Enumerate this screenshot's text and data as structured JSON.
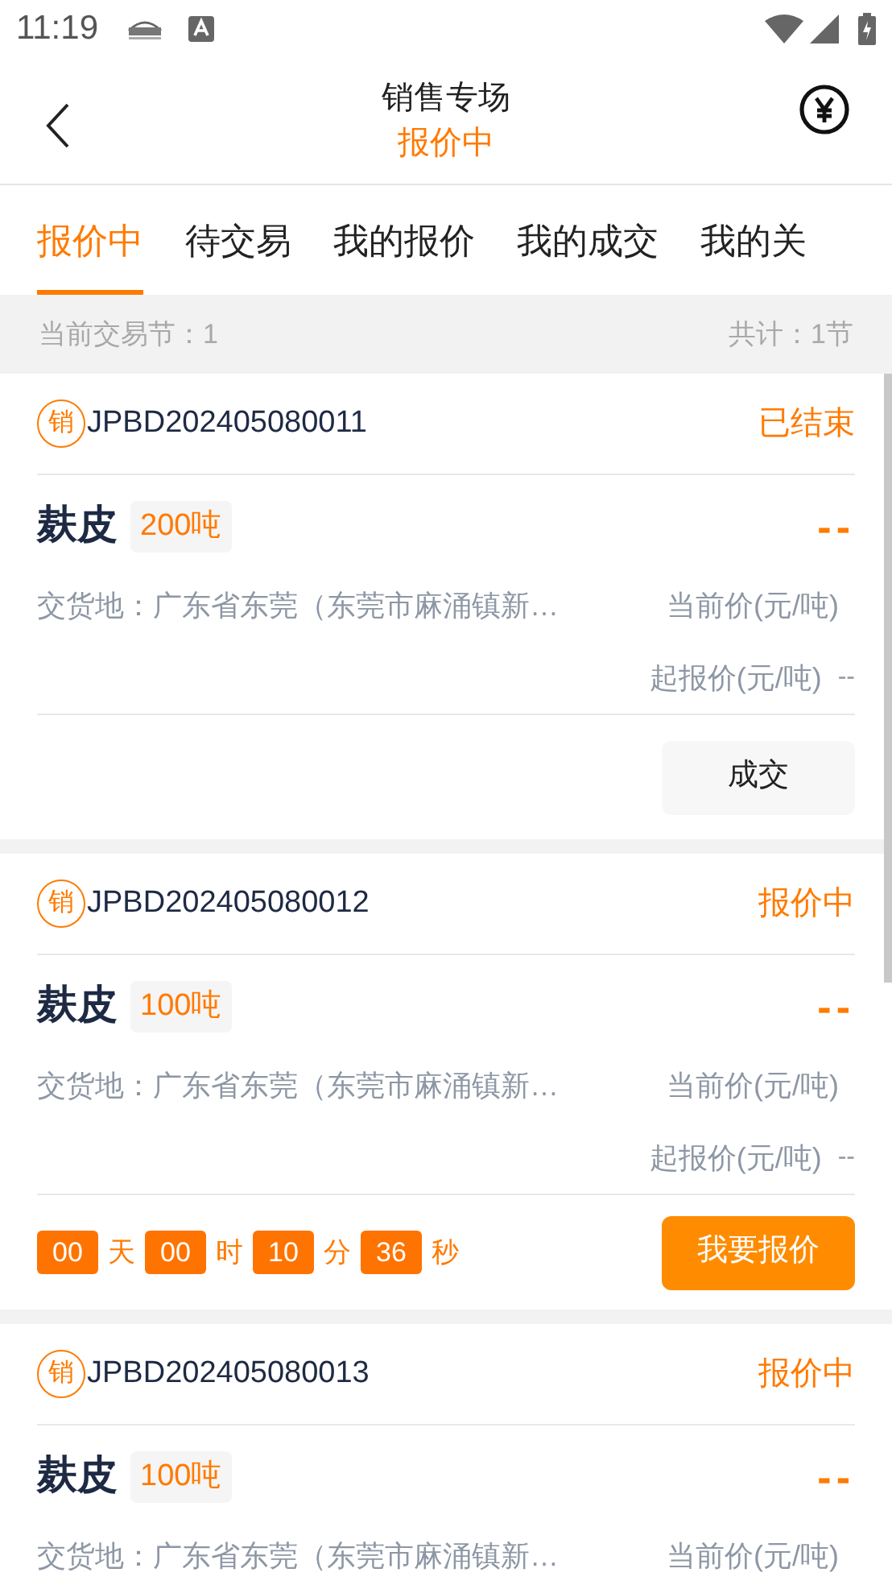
{
  "status_bar": {
    "time": "11:19"
  },
  "header": {
    "title": "销售专场",
    "subtitle": "报价中"
  },
  "tabs": [
    {
      "label": "报价中",
      "selected": true
    },
    {
      "label": "待交易",
      "selected": false
    },
    {
      "label": "我的报价",
      "selected": false
    },
    {
      "label": "我的成交",
      "selected": false
    },
    {
      "label": "我的关",
      "selected": false
    }
  ],
  "info_bar": {
    "session": "当前交易节：1",
    "total": "共计：1节"
  },
  "cards": [
    {
      "badge": "销",
      "code": "JPBD202405080011",
      "status": "已结束",
      "product": "麸皮",
      "quantity": "200吨",
      "price": "--",
      "location": "交货地：广东省东莞（东莞市麻涌镇新…",
      "current_price_label": "当前价(元/吨)",
      "start_price_label": "起报价(元/吨)",
      "start_price": "--",
      "action": {
        "label": "成交",
        "kind": "plain"
      }
    },
    {
      "badge": "销",
      "code": "JPBD202405080012",
      "status": "报价中",
      "product": "麸皮",
      "quantity": "100吨",
      "price": "--",
      "location": "交货地：广东省东莞（东莞市麻涌镇新…",
      "current_price_label": "当前价(元/吨)",
      "start_price_label": "起报价(元/吨)",
      "start_price": "--",
      "countdown": [
        {
          "value": "00",
          "unit": "天"
        },
        {
          "value": "00",
          "unit": "时"
        },
        {
          "value": "10",
          "unit": "分"
        },
        {
          "value": "36",
          "unit": "秒"
        }
      ],
      "action": {
        "label": "我要报价",
        "kind": "primary"
      }
    },
    {
      "badge": "销",
      "code": "JPBD202405080013",
      "status": "报价中",
      "product": "麸皮",
      "quantity": "100吨",
      "price": "--",
      "location": "交货地：广东省东莞（东莞市麻涌镇新…",
      "current_price_label": "当前价(元/吨)"
    }
  ]
}
